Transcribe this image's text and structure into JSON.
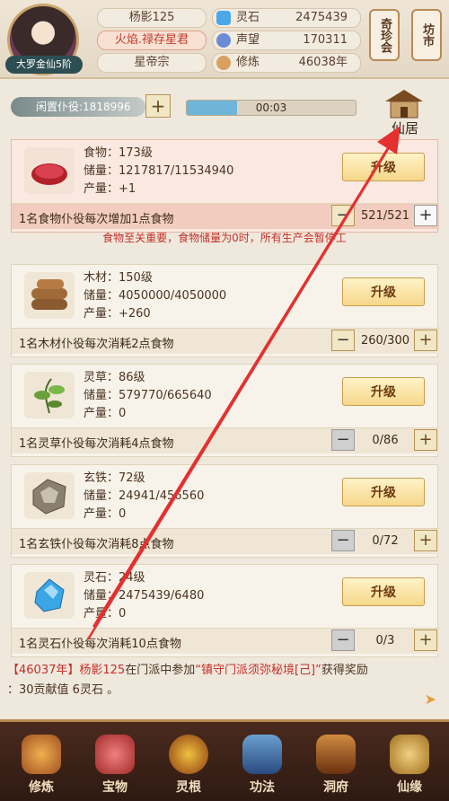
{
  "header": {
    "avatar_rank": "大罗金仙5阶",
    "name": "杨影125",
    "title": "火焰.禄存星君",
    "sect": "星帝宗",
    "resources": [
      {
        "label": "灵石",
        "value": "2475439",
        "color": "#4aa8e8",
        "icon": "spirit-stone-icon"
      },
      {
        "label": "声望",
        "value": "170311",
        "color": "#6a8bd6",
        "icon": "prestige-icon"
      },
      {
        "label": "修炼",
        "value": "46038年",
        "color": "#d9a062",
        "icon": "cultivation-icon"
      }
    ],
    "side_buttons": [
      "奇珍会",
      "坊市"
    ]
  },
  "top": {
    "idle_label": "闲置仆役:1818996",
    "progress_time": "00:03",
    "progress_fraction": 0.3,
    "house_label": "仙居"
  },
  "cards": [
    {
      "name": "食物",
      "level": "173级",
      "storage": "储量：1217817/11534940",
      "output": "产量：+1",
      "name_line": "食物：173级",
      "button": "升级",
      "desc": "1名食物仆役每次增加1点食物",
      "count": "521/521"
    },
    {
      "name_line": "木材：150级",
      "storage": "储量：4050000/4050000",
      "output": "产量：+260",
      "button": "升级",
      "desc": "1名木材仆役每次消耗2点食物",
      "count": "260/300"
    },
    {
      "name_line": "灵草：86级",
      "storage": "储量：579770/665640",
      "output": "产量：0",
      "button": "升级",
      "desc": "1名灵草仆役每次消耗4点食物",
      "count": "0/86"
    },
    {
      "name_line": "玄铁：72级",
      "storage": "储量：24941/456560",
      "output": "产量：0",
      "button": "升级",
      "desc": "1名玄铁仆役每次消耗8点食物",
      "count": "0/72"
    },
    {
      "name_line": "灵石：24级",
      "storage": "储量：2475439/6480",
      "output": "产量：0",
      "button": "升级",
      "desc": "1名灵石仆役每次消耗10点食物",
      "count": "0/3"
    }
  ],
  "warning": "食物至关重要，食物储量为0时，所有生产会暂停工",
  "log": {
    "year": "【46037年】",
    "player": "杨影125",
    "text1": "在门派中参加",
    "event": "“镇守门派须弥秘境[己]”",
    "text2": "获得奖励",
    "reward": "：30贡献值 6灵石 。"
  },
  "nav": [
    "修炼",
    "宝物",
    "灵根",
    "功法",
    "洞府",
    "仙缘"
  ]
}
